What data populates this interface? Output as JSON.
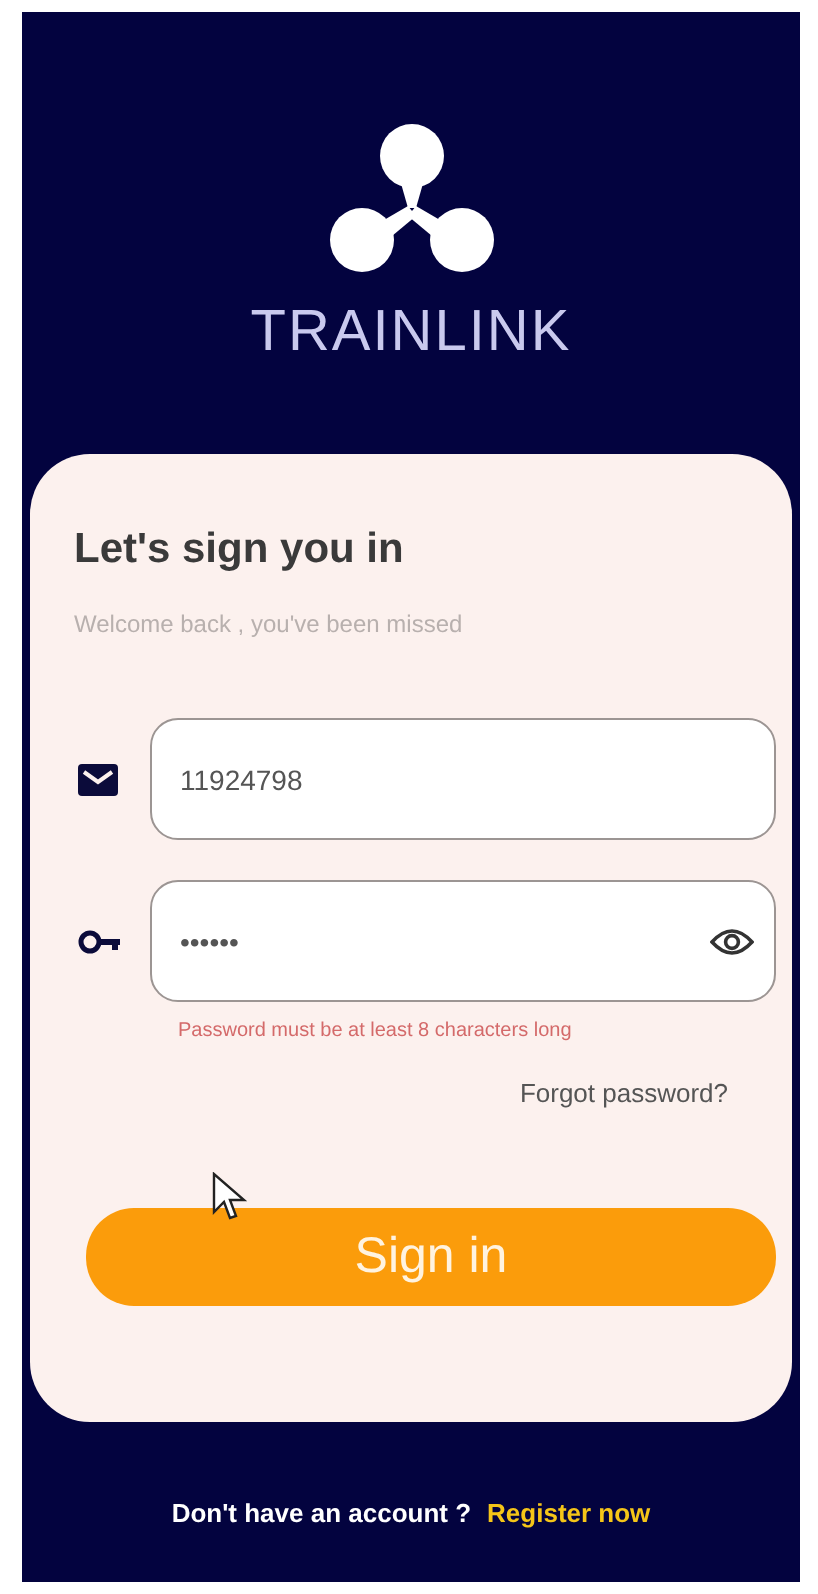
{
  "brand": {
    "name": "TRAINLINK"
  },
  "card": {
    "title": "Let's sign you in",
    "subtitle": "Welcome back , you've been missed"
  },
  "fields": [
    {
      "kind": "email",
      "value": "11924798"
    },
    {
      "kind": "password",
      "value": "••••••"
    }
  ],
  "error": "Password must be at least 8 characters long",
  "forgot_link": "Forgot password?",
  "submit": "Sign in",
  "footer": {
    "text": "Don't have an account ?",
    "link": "Register now"
  }
}
